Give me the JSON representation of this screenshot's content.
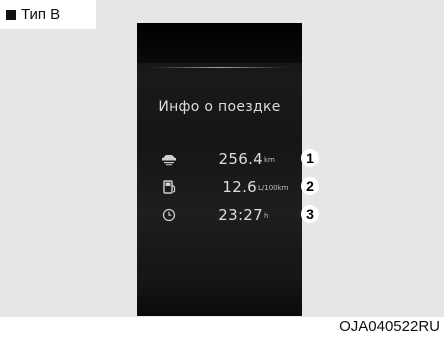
{
  "type_label": "Тип B",
  "screen": {
    "title": "Инфо о поездке",
    "rows": [
      {
        "icon": "distance-icon",
        "value": "256.4",
        "unit": "km",
        "marker": "1"
      },
      {
        "icon": "fuel-economy-icon",
        "value": "12.6",
        "unit": "L/100km",
        "marker": "2"
      },
      {
        "icon": "clock-icon",
        "value": "23:27",
        "unit": "h",
        "marker": "3"
      }
    ]
  },
  "figure_code": "OJA040522RU"
}
